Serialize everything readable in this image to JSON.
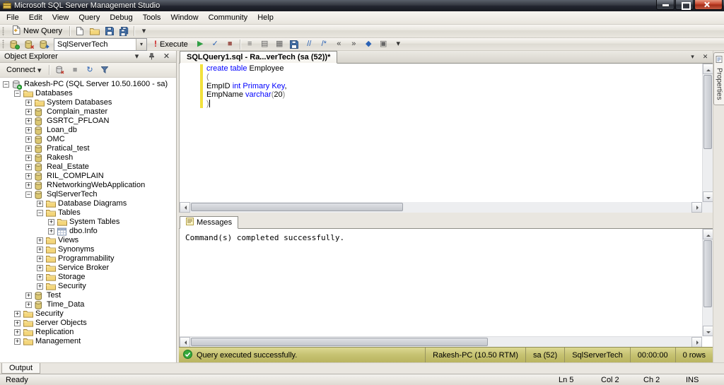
{
  "window": {
    "title": "Microsoft SQL Server Management Studio",
    "status_ready": "Ready",
    "status_cells": [
      "Ln 5",
      "Col 2",
      "Ch 2",
      "INS"
    ]
  },
  "menu": {
    "items": [
      "File",
      "Edit",
      "View",
      "Query",
      "Debug",
      "Tools",
      "Window",
      "Community",
      "Help"
    ]
  },
  "toolbar_standard": {
    "new_query_label": "New Query",
    "icons": [
      "doc-icon",
      "open-folder-icon",
      "save-icon",
      "save-all-icon"
    ]
  },
  "toolbar_sql": {
    "left_icons": [
      "connect-icon",
      "disconnect-icon",
      "change-connection-icon"
    ],
    "database_dropdown": "SqlServerTech",
    "execute_label": "Execute",
    "mid_icons": [
      "debug-icon",
      "parse-icon",
      "cancel-query-icon"
    ],
    "right_icons": [
      "sqlcmd-icon",
      "results-text-icon",
      "results-grid-icon",
      "results-file-icon",
      "comment-icon",
      "uncomment-icon",
      "outdent-icon",
      "indent-icon",
      "intellisense-icon",
      "snippets-icon"
    ]
  },
  "object_explorer": {
    "title": "Object Explorer",
    "connect_label": "Connect",
    "header_icons": [
      "chevron-down-icon",
      "pin-icon",
      "close-icon"
    ],
    "toolbar_icons": [
      "disconnect-server-icon",
      "stop-process-icon",
      "refresh-icon",
      "filter-icon"
    ],
    "tree": [
      {
        "label": "Rakesh-PC (SQL Server 10.50.1600 - sa)",
        "level": 0,
        "toggle": "minus",
        "icon": "server-icon"
      },
      {
        "label": "Databases",
        "level": 1,
        "toggle": "minus",
        "icon": "folder-icon"
      },
      {
        "label": "System Databases",
        "level": 2,
        "toggle": "plus",
        "icon": "folder-icon"
      },
      {
        "label": "Complain_master",
        "level": 2,
        "toggle": "plus",
        "icon": "database-icon"
      },
      {
        "label": "GSRTC_PFLOAN",
        "level": 2,
        "toggle": "plus",
        "icon": "database-icon"
      },
      {
        "label": "Loan_db",
        "level": 2,
        "toggle": "plus",
        "icon": "database-icon"
      },
      {
        "label": "OMC",
        "level": 2,
        "toggle": "plus",
        "icon": "database-icon"
      },
      {
        "label": "Pratical_test",
        "level": 2,
        "toggle": "plus",
        "icon": "database-icon"
      },
      {
        "label": "Rakesh",
        "level": 2,
        "toggle": "plus",
        "icon": "database-icon"
      },
      {
        "label": "Real_Estate",
        "level": 2,
        "toggle": "plus",
        "icon": "database-icon"
      },
      {
        "label": "RIL_COMPLAIN",
        "level": 2,
        "toggle": "plus",
        "icon": "database-icon"
      },
      {
        "label": "RNetworkingWebApplication",
        "level": 2,
        "toggle": "plus",
        "icon": "database-icon"
      },
      {
        "label": "SqlServerTech",
        "level": 2,
        "toggle": "minus",
        "icon": "database-icon"
      },
      {
        "label": "Database Diagrams",
        "level": 3,
        "toggle": "plus",
        "icon": "folder-icon"
      },
      {
        "label": "Tables",
        "level": 3,
        "toggle": "minus",
        "icon": "folder-icon"
      },
      {
        "label": "System Tables",
        "level": 4,
        "toggle": "plus",
        "icon": "folder-icon"
      },
      {
        "label": "dbo.Info",
        "level": 4,
        "toggle": "plus",
        "icon": "table-icon"
      },
      {
        "label": "Views",
        "level": 3,
        "toggle": "plus",
        "icon": "folder-icon"
      },
      {
        "label": "Synonyms",
        "level": 3,
        "toggle": "plus",
        "icon": "folder-icon"
      },
      {
        "label": "Programmability",
        "level": 3,
        "toggle": "plus",
        "icon": "folder-icon"
      },
      {
        "label": "Service Broker",
        "level": 3,
        "toggle": "plus",
        "icon": "folder-icon"
      },
      {
        "label": "Storage",
        "level": 3,
        "toggle": "plus",
        "icon": "folder-icon"
      },
      {
        "label": "Security",
        "level": 3,
        "toggle": "plus",
        "icon": "folder-icon"
      },
      {
        "label": "Test",
        "level": 2,
        "toggle": "plus",
        "icon": "database-icon"
      },
      {
        "label": "Time_Data",
        "level": 2,
        "toggle": "plus",
        "icon": "database-icon"
      },
      {
        "label": "Security",
        "level": 1,
        "toggle": "plus",
        "icon": "folder-icon"
      },
      {
        "label": "Server Objects",
        "level": 1,
        "toggle": "plus",
        "icon": "folder-icon"
      },
      {
        "label": "Replication",
        "level": 1,
        "toggle": "plus",
        "icon": "folder-icon"
      },
      {
        "label": "Management",
        "level": 1,
        "toggle": "plus",
        "icon": "folder-icon"
      }
    ]
  },
  "editor": {
    "tab_title": "SQLQuery1.sql - Ra...verTech (sa (52))*",
    "syntax_colors": {
      "keyword": "#0000ff",
      "plain": "#000000",
      "paren": "#808080"
    },
    "lines": [
      [
        {
          "text": "create table",
          "style": "keyword"
        },
        {
          "text": " Employee",
          "style": "plain"
        }
      ],
      [
        {
          "text": "(",
          "style": "paren"
        }
      ],
      [
        {
          "text": "EmpID ",
          "style": "plain"
        },
        {
          "text": "int",
          "style": "keyword"
        },
        {
          "text": " ",
          "style": "plain"
        },
        {
          "text": "Primary Key",
          "style": "keyword"
        },
        {
          "text": ",",
          "style": "plain"
        }
      ],
      [
        {
          "text": "EmpName ",
          "style": "plain"
        },
        {
          "text": "varchar",
          "style": "keyword"
        },
        {
          "text": "(",
          "style": "paren"
        },
        {
          "text": "20",
          "style": "plain"
        },
        {
          "text": ")",
          "style": "paren"
        }
      ],
      [
        {
          "text": ")",
          "style": "paren"
        }
      ]
    ]
  },
  "messages_panel": {
    "tab_label": "Messages",
    "text": "Command(s) completed successfully."
  },
  "query_status": {
    "text": "Query executed successfully.",
    "cells": [
      "Rakesh-PC (10.50 RTM)",
      "sa (52)",
      "SqlServerTech",
      "00:00:00",
      "0 rows"
    ],
    "bar_color": "#c6c271"
  },
  "output_tab": {
    "label": "Output"
  },
  "properties_tab": {
    "label": "Properties"
  }
}
